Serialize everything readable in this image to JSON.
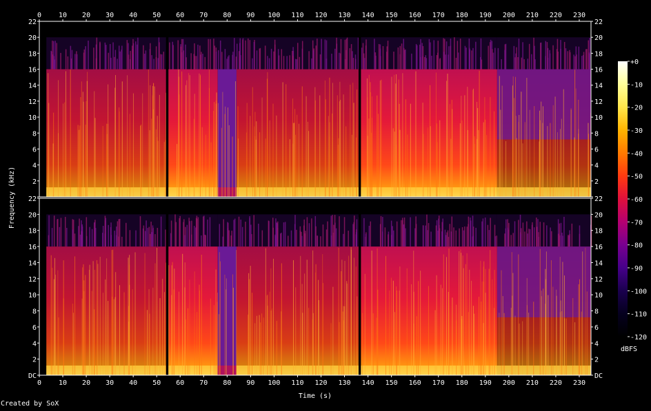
{
  "chart_data": {
    "type": "heatmap",
    "title": "",
    "xlabel": "Time (s)",
    "ylabel": "Frequency (kHz)",
    "xlim": [
      0,
      235
    ],
    "ylim": [
      0,
      22
    ],
    "x_ticks": [
      "0",
      "10",
      "20",
      "30",
      "40",
      "50",
      "60",
      "70",
      "80",
      "90",
      "100",
      "110",
      "120",
      "130",
      "140",
      "150",
      "160",
      "170",
      "180",
      "190",
      "200",
      "210",
      "220",
      "230"
    ],
    "channels": [
      {
        "name": "",
        "y_ticks": [
          "DC",
          "2",
          "4",
          "6",
          "8",
          "10",
          "12",
          "14",
          "16",
          "18",
          "20",
          "22"
        ]
      },
      {
        "name": "",
        "y_ticks": [
          "DC",
          "2",
          "4",
          "6",
          "8",
          "10",
          "12",
          "14",
          "16",
          "18",
          "20",
          "22"
        ]
      }
    ],
    "colorbar": {
      "label": "dBFS",
      "range": [
        -120,
        0
      ],
      "ticks": [
        "+0",
        "-10",
        "-20",
        "-30",
        "-40",
        "-50",
        "-60",
        "-70",
        "-80",
        "-90",
        "-100",
        "-110",
        "-120"
      ],
      "colors": [
        "#ffffff",
        "#ffff9a",
        "#ffe64a",
        "#ffb400",
        "#ff7a00",
        "#ff3a10",
        "#e0103c",
        "#b40070",
        "#780090",
        "#46008a",
        "#1a004e",
        "#05001e",
        "#000000"
      ]
    },
    "segments_s": [
      {
        "start": 0,
        "end": 3,
        "level": "quiet"
      },
      {
        "start": 3,
        "end": 54,
        "level": "medium",
        "cutoff_khz": 16
      },
      {
        "start": 54,
        "end": 55,
        "level": "quiet"
      },
      {
        "start": 55,
        "end": 76,
        "level": "loud",
        "cutoff_khz": 16
      },
      {
        "start": 76,
        "end": 84,
        "level": "low",
        "cutoff_khz": 16
      },
      {
        "start": 84,
        "end": 136,
        "level": "medium",
        "cutoff_khz": 16
      },
      {
        "start": 136,
        "end": 137,
        "level": "quiet"
      },
      {
        "start": 137,
        "end": 195,
        "level": "loud",
        "cutoff_khz": 16
      },
      {
        "start": 195,
        "end": 235,
        "level": "fade",
        "cutoff_khz": 16
      }
    ],
    "footer": "Created by SoX"
  }
}
